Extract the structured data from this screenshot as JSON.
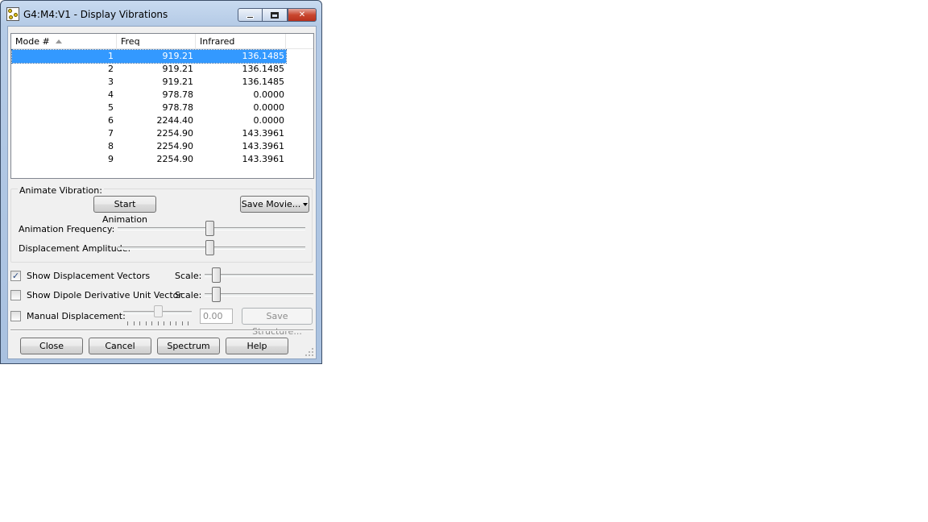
{
  "window": {
    "title": "G4:M4:V1 - Display Vibrations",
    "min_glyph": "minimize-icon",
    "max_glyph": "maximize-icon",
    "close_glyph": "✕"
  },
  "modes_table": {
    "columns": [
      "Mode #",
      "Freq",
      "Infrared"
    ],
    "sort_column": "Mode #",
    "sort_direction": "ascending",
    "rows": [
      {
        "mode": "1",
        "freq": "919.21",
        "ir": "136.1485",
        "selected": true
      },
      {
        "mode": "2",
        "freq": "919.21",
        "ir": "136.1485"
      },
      {
        "mode": "3",
        "freq": "919.21",
        "ir": "136.1485"
      },
      {
        "mode": "4",
        "freq": "978.78",
        "ir": "0.0000"
      },
      {
        "mode": "5",
        "freq": "978.78",
        "ir": "0.0000"
      },
      {
        "mode": "6",
        "freq": "2244.40",
        "ir": "0.0000"
      },
      {
        "mode": "7",
        "freq": "2254.90",
        "ir": "143.3961"
      },
      {
        "mode": "8",
        "freq": "2254.90",
        "ir": "143.3961"
      },
      {
        "mode": "9",
        "freq": "2254.90",
        "ir": "143.3961"
      }
    ]
  },
  "animate": {
    "group_label": "Animate Vibration:",
    "start_button": "Start Animation",
    "save_movie_button": "Save Movie...",
    "frequency_label": "Animation Frequency:",
    "frequency_level": 0.49,
    "amplitude_label": "Displacement Amplitude:",
    "amplitude_level": 0.49
  },
  "options": {
    "show_vectors_label": "Show Displacement Vectors",
    "show_vectors_checked": true,
    "vectors_scale_label": "Scale:",
    "vectors_scale_level": 0.06,
    "show_dipole_label": "Show Dipole Derivative Unit Vector",
    "show_dipole_checked": false,
    "dipole_scale_label": "Scale:",
    "dipole_scale_level": 0.06,
    "manual_label": "Manual Displacement:",
    "manual_checked": false,
    "manual_level": 0.5,
    "manual_value": "0.00",
    "save_structure_button": "Save Structure..."
  },
  "buttons": {
    "close": "Close",
    "cancel": "Cancel",
    "spectrum": "Spectrum",
    "help": "Help"
  },
  "colors": {
    "selection": "#3399ff",
    "close_button": "#c9462f"
  }
}
